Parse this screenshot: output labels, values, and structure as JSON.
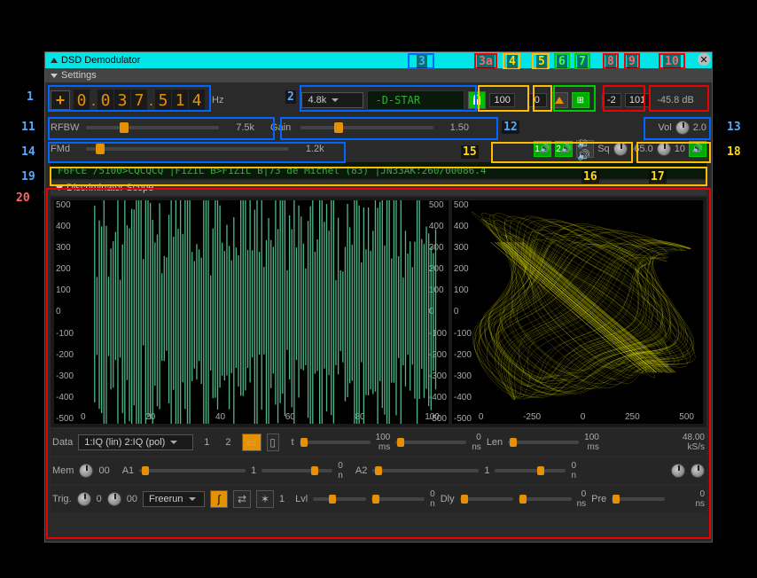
{
  "title": "DSD Demodulator",
  "settings_label": "Settings",
  "row1": {
    "freq_digits": [
      "0",
      "0",
      "3",
      "7",
      "5",
      "1",
      "4"
    ],
    "hz": "Hz",
    "bw_select": "4.8k",
    "mode_text": "-D-STAR",
    "val100": "100",
    "val0": "0",
    "val_neg2": "-2",
    "val101": "101",
    "db": "-45.8 dB"
  },
  "row2": {
    "rfbw_label": "RFBW",
    "rfbw_val": "7.5k",
    "gain_label": "Gain",
    "gain_val": "1.50",
    "vol_label": "Vol",
    "vol_val": "2.0"
  },
  "row3": {
    "fmd_label": "FMd",
    "fmd_val": "1.2k",
    "sq_label": "Sq",
    "sq_val": "-65.0",
    "val10": "10",
    "btn1": "1",
    "btn2": "2"
  },
  "status": "F6FCE  /5100>CQCQCQ  |F1ZIL  B>F1ZIL  B|73 de Michel (83)  |JN33AK:260/00086.4",
  "scope_title": "Discriminator Scope",
  "chart_data": [
    {
      "type": "line",
      "title": "",
      "y_ticks": [
        "500",
        "400",
        "300",
        "200",
        "100",
        "0",
        "-100",
        "-200",
        "-300",
        "-400",
        "-500"
      ],
      "x_ticks": [
        "0",
        "20",
        "40",
        "60",
        "80",
        "100"
      ]
    },
    {
      "type": "scatter",
      "title": "",
      "y_ticks": [
        "500",
        "400",
        "300",
        "200",
        "100",
        "0",
        "-100",
        "-200",
        "-300",
        "-400",
        "-500"
      ],
      "x_ticks": [
        "0",
        "-250",
        "0",
        "250",
        "500"
      ]
    }
  ],
  "data_row": {
    "label": "Data",
    "select": "1:IQ (lin) 2:IQ (pol)",
    "n1": "1",
    "n2": "2",
    "t": "t",
    "t100": "100",
    "ms": "ms",
    "t0": "0",
    "ns": "ns",
    "len": "Len",
    "l100": "100",
    "rate": "48.00",
    "ksps": "kS/s"
  },
  "mem_row": {
    "label": "Mem",
    "v00": "00",
    "a1": "A1",
    "n1": "1",
    "v0": "0",
    "n": "n",
    "a2": "A2",
    "n1b": "1",
    "v0b": "0"
  },
  "trig_row": {
    "label": "Trig.",
    "v0": "0",
    "v00": "00",
    "mode": "Freerun",
    "n1": "1",
    "lvl": "Lvl",
    "lvl0": "0",
    "n": "n",
    "dly": "Dly",
    "d0": "0",
    "ns": "ns",
    "pre": "Pre",
    "p0": "0"
  },
  "anno": {
    "1": "1",
    "2": "2",
    "3": "3",
    "3a": "3a",
    "4": "4",
    "5": "5",
    "6": "6",
    "7": "7",
    "8": "8",
    "9": "9",
    "10": "10",
    "11": "11",
    "12": "12",
    "13": "13",
    "14": "14",
    "15": "15",
    "16": "16",
    "17": "17",
    "18": "18",
    "19": "19",
    "20": "20"
  }
}
